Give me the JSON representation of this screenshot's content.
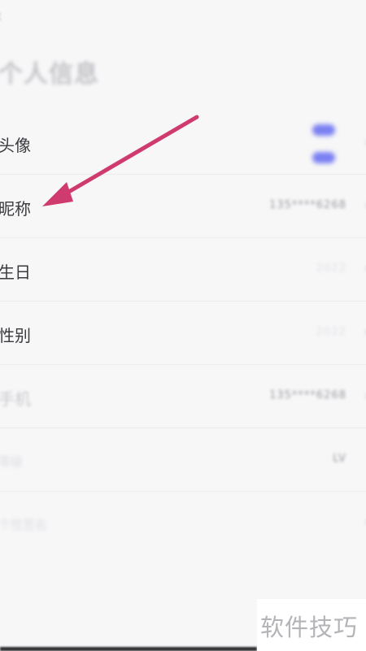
{
  "header": {
    "back_icon": "‹",
    "title": "个人信息"
  },
  "rows": [
    {
      "label": "头像",
      "value": "",
      "chevron": "›"
    },
    {
      "label": "昵称",
      "value": "135****6268",
      "chevron": "›"
    },
    {
      "label": "生日",
      "value": "2022",
      "chevron": "›"
    },
    {
      "label": "性别",
      "value": "2022",
      "chevron": "›"
    },
    {
      "label": "手机",
      "value": "135****6268",
      "chevron": "›"
    },
    {
      "label": "等级",
      "value": "LV",
      "chevron": ""
    },
    {
      "label": "个性签名",
      "value": "",
      "chevron": "›"
    }
  ],
  "colors": {
    "arrow": "#d03b6f",
    "avatar_accent": "#7a7ff2"
  },
  "watermark": {
    "text": "软件技巧"
  }
}
